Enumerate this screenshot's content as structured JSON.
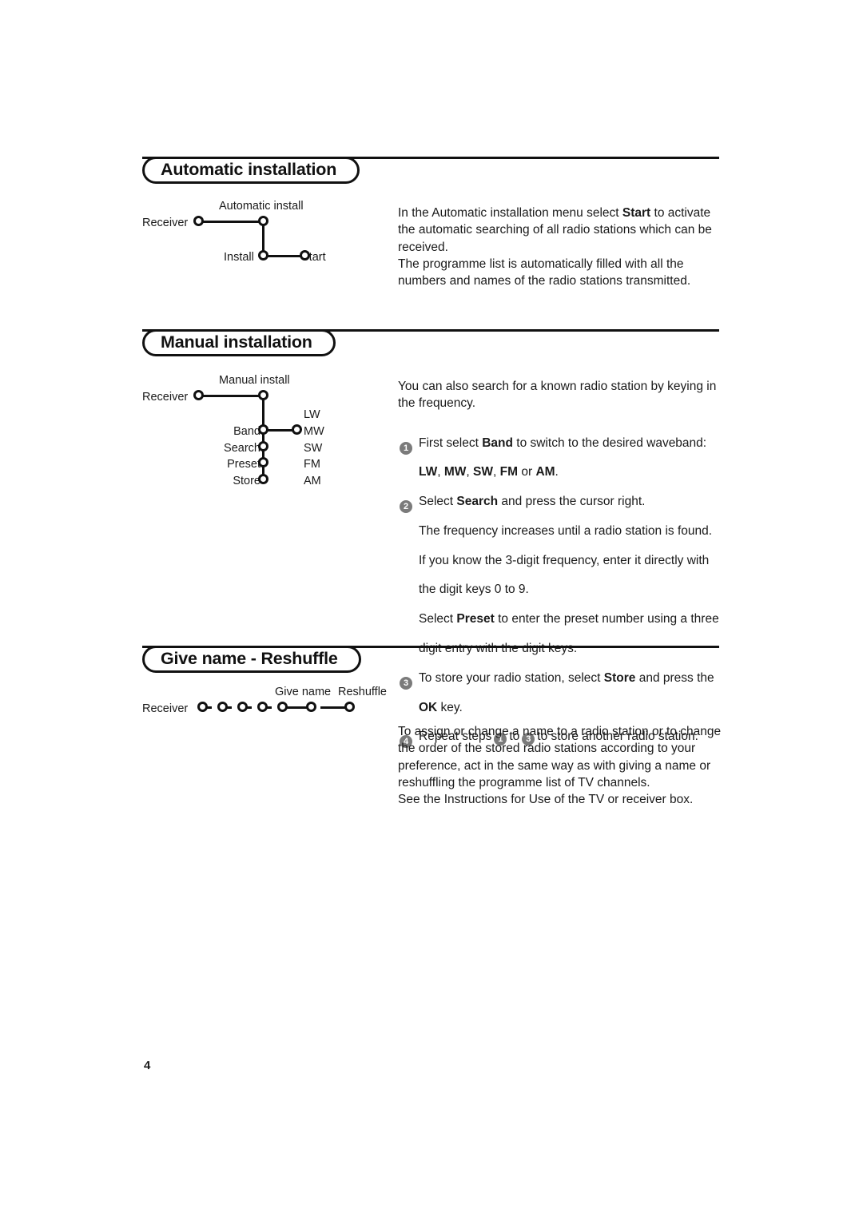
{
  "page": {
    "number": "4"
  },
  "sections": [
    {
      "id": "automatic-installation",
      "title": "Automatic installation",
      "diagram": {
        "labels": {
          "receiver": "Receiver",
          "automatic_install": "Automatic install",
          "install": "Install",
          "start": "Start"
        }
      },
      "body": [
        "In the Automatic installation menu select ",
        "Start",
        " to activate the automatic searching of all radio stations which can be received.",
        "The programme list is automatically filled with all the numbers and names of the radio stations transmitted."
      ],
      "body_lines": [
        "In the Automatic installation menu select Start to activate",
        "the automatic searching of all radio stations which can be",
        "received.",
        "The programme list is automatically filled with all the",
        "numbers and names of the radio stations transmitted."
      ]
    },
    {
      "id": "manual-installation",
      "title": "Manual installation",
      "diagram": {
        "labels": {
          "receiver": "Receiver",
          "manual_install": "Manual install",
          "band": "Band",
          "search": "Search",
          "preset": "Preset",
          "store": "Store"
        },
        "bands": [
          "LW",
          "MW",
          "SW",
          "FM",
          "AM"
        ]
      },
      "intro_lines": [
        "You can also search for a known radio station by keying in",
        "the frequency."
      ],
      "steps": [
        {
          "number": "1",
          "lines": [
            "First select Band to switch to the desired waveband:",
            "LW, MW, SW, FM or AM."
          ]
        },
        {
          "number": "2",
          "lines": [
            "Select Search and press the cursor right.",
            "The frequency increases until a radio station is found.",
            "If you know the 3-digit frequency, enter it directly with",
            "the digit keys 0 to 9.",
            "Select Preset to enter the preset number using a three",
            "digit entry with the digit keys."
          ]
        },
        {
          "number": "3",
          "lines": [
            "To store your radio station, select Store and press the",
            "OK key."
          ]
        },
        {
          "number": "4",
          "lines": [
            "Repeat steps 1 to 3 to store another radio station."
          ],
          "inline_refs": [
            "1",
            "3"
          ],
          "prefix": "Repeat steps",
          "mid": "to",
          "suffix": "to store another radio station."
        }
      ]
    },
    {
      "id": "give-name-reshuffle",
      "title": "Give name - Reshuffle",
      "diagram": {
        "labels": {
          "receiver": "Receiver",
          "give_name": "Give name",
          "reshuffle": "Reshuffle"
        }
      },
      "body_lines": [
        "To assign or change a name to a radio station or to change",
        "the order of the stored radio stations according to your",
        "preference, act in the same way as with giving a name or",
        "reshuffling the programme list of TV channels.",
        "See the Instructions for Use of the TV or receiver box."
      ]
    }
  ],
  "colors": {
    "ink": "#1a1a1a",
    "rule": "#111111",
    "badge": "#7b7b7b",
    "badge_text": "#ffffff",
    "background": "#ffffff"
  }
}
